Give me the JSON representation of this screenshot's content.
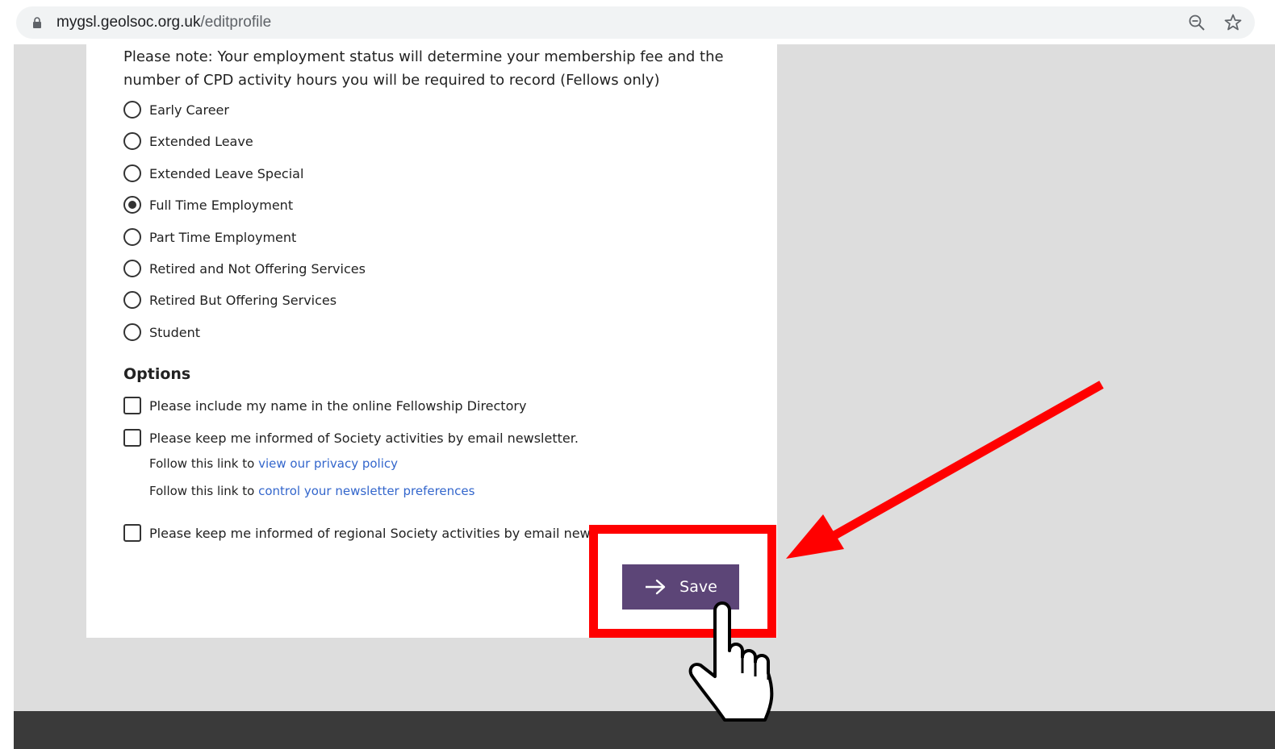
{
  "browser": {
    "url_host": "mygsl.geolsoc.org.uk",
    "url_path": "/editprofile",
    "icons": [
      "lock-icon",
      "zoom-out-icon",
      "star-icon"
    ]
  },
  "form": {
    "note": "Please note:  Your employment status will determine your membership fee and the number of CPD activity hours you will be required to record (Fellows only)",
    "employment_options": [
      {
        "label": "Early Career",
        "checked": false
      },
      {
        "label": "Extended Leave",
        "checked": false
      },
      {
        "label": "Extended Leave Special",
        "checked": false
      },
      {
        "label": "Full Time Employment",
        "checked": true
      },
      {
        "label": "Part Time Employment",
        "checked": false
      },
      {
        "label": "Retired and Not Offering Services",
        "checked": false
      },
      {
        "label": "Retired But Offering Services",
        "checked": false
      },
      {
        "label": "Student",
        "checked": false
      }
    ],
    "options_heading": "Options",
    "checkboxes": [
      {
        "label": "Please include my name in the online Fellowship Directory",
        "checked": false
      },
      {
        "label": "Please keep me informed of Society activities by email newsletter.",
        "checked": false
      },
      {
        "label": "Please keep me informed of regional Society activities by email newsletter.",
        "checked": false
      }
    ],
    "follow_prefix": "Follow this link to",
    "privacy_link": "view our privacy policy",
    "newsletter_link": "control your newsletter preferences",
    "save_label": "Save"
  },
  "colors": {
    "save_button": "#5c4577",
    "link": "#3366cc",
    "annotation": "#ff0000"
  }
}
